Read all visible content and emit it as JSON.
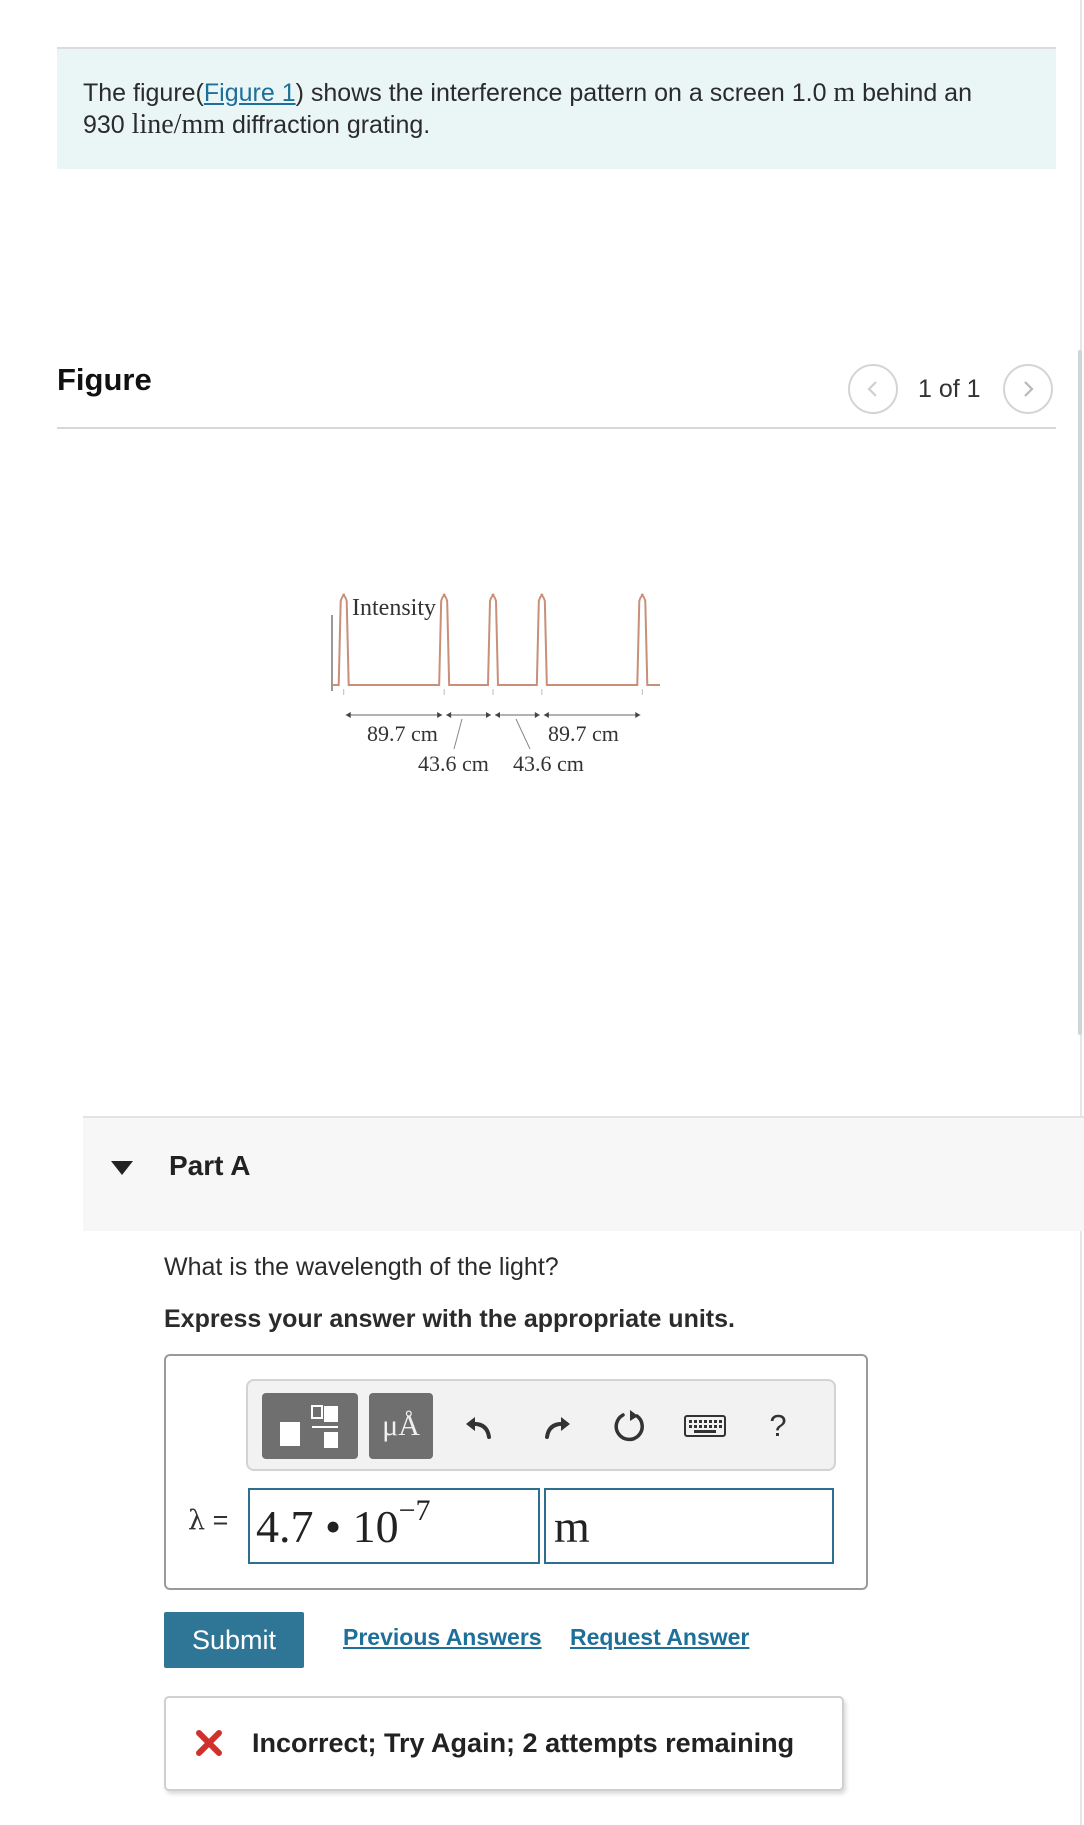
{
  "problem": {
    "text_before": "The figure(",
    "figure_link": "Figure 1",
    "text_after": ") shows the interference pattern on a screen 1.0 ",
    "unit_m": "m",
    "text_mid": " behind an",
    "text_line2_number": "930 ",
    "unit_line_mm": "line/mm",
    "text_end": " diffraction grating."
  },
  "figure": {
    "header": "Figure",
    "pager": {
      "count": "1 of 1",
      "prev_icon": "chevron-left-icon",
      "next_icon": "chevron-right-icon"
    }
  },
  "chart_data": {
    "type": "line",
    "ylabel": "Intensity",
    "peak_positions_cm": [
      -133.3,
      -43.6,
      0,
      43.6,
      133.3
    ],
    "spacing_annotations": [
      "89.7 cm",
      "43.6 cm",
      "43.6 cm",
      "89.7 cm"
    ],
    "line_color": "#c98f78"
  },
  "part_a": {
    "title": "Part A",
    "question": "What is the wavelength of the light?",
    "instruction": "Express your answer with the appropriate units.",
    "toolbar": {
      "template_icon": "template-icon",
      "units_label": "μÅ",
      "undo_icon": "undo-icon",
      "redo_icon": "redo-icon",
      "reset_icon": "reset-icon",
      "keyboard_icon": "keyboard-icon",
      "help_label": "?"
    },
    "variable_symbol": "λ",
    "equals": " =",
    "value_mantissa": "4.7 • 10",
    "value_exponent": "−7",
    "unit_value": "m",
    "submit_label": "Submit",
    "previous_answers_label": "Previous Answers",
    "request_answer_label": "Request Answer",
    "feedback_message": "Incorrect; Try Again; 2 attempts remaining",
    "feedback_icon": "x-icon",
    "feedback_color": "#d0312d"
  }
}
